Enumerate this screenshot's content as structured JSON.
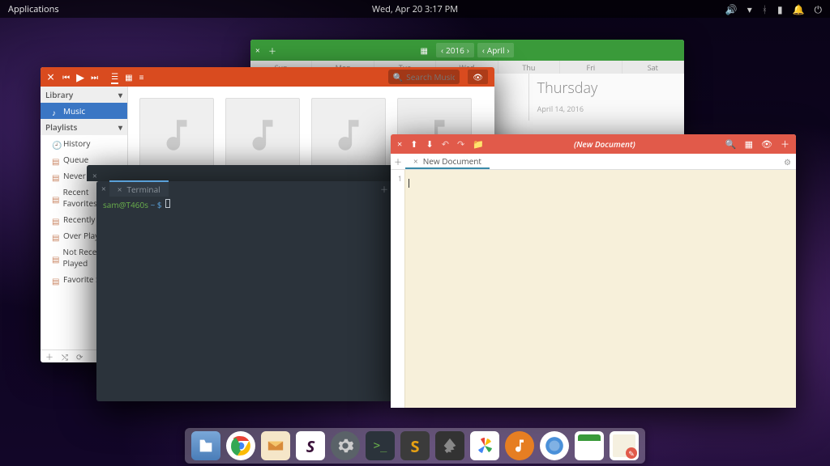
{
  "panel": {
    "applications": "Applications",
    "datetime": "Wed, Apr 20   3:17 PM"
  },
  "calendar": {
    "year": "2016",
    "month": "April",
    "days": [
      "Sun",
      "Mon",
      "Tue",
      "Wed",
      "Thu",
      "Fri",
      "Sat"
    ],
    "side_day": "Thursday",
    "side_date": "April 14, 2016"
  },
  "music": {
    "search_placeholder": "Search Music",
    "sections": {
      "library": "Library",
      "playlists": "Playlists"
    },
    "library_items": [
      "Music"
    ],
    "playlist_items": [
      "History",
      "Queue",
      "Never Played",
      "Recent Favorites",
      "Recently Added",
      "Over Played",
      "Not Recently Played",
      "Favorite Songs"
    ]
  },
  "terminal": {
    "tab_title": "Terminal",
    "prompt_user": "sam@T460s",
    "prompt_path": "~",
    "prompt_symbol": "$"
  },
  "editor": {
    "title": "(New Document)",
    "tab": "New Document",
    "line": "1"
  },
  "dock": {
    "apps": [
      "files",
      "chrome",
      "mail",
      "slack",
      "settings",
      "terminal",
      "sublime",
      "inkscape",
      "photos",
      "music",
      "web",
      "calendar",
      "editor"
    ]
  }
}
